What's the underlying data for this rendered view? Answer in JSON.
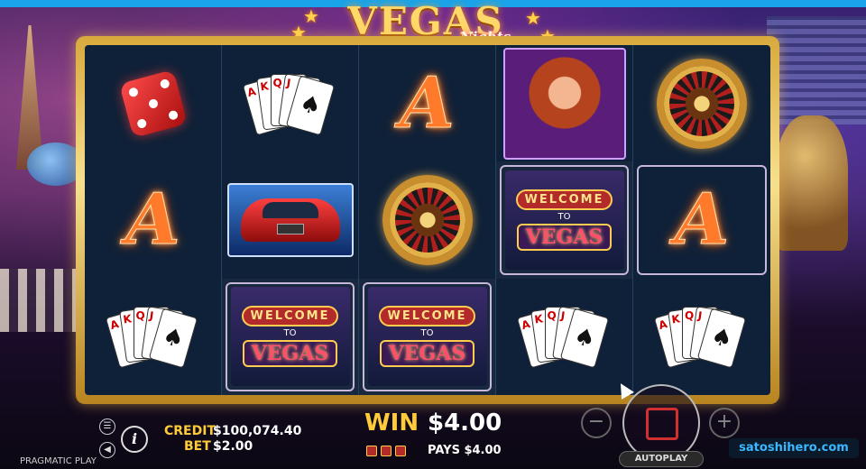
{
  "game": {
    "logo_main": "VEGAS",
    "logo_sub": "Nights",
    "provider": "PRAGMATIC PLAY",
    "watermark_site": "satoshihero.com"
  },
  "reels": [
    [
      "red-dice",
      "playing-cards",
      "letter-a"
    ],
    [
      "playing-cards",
      "red-car",
      "welcome-to-vegas-sign"
    ],
    [
      "letter-a",
      "roulette-wheel",
      "welcome-to-vegas-sign"
    ],
    [
      "lady-portrait",
      "welcome-to-vegas-sign",
      "playing-cards"
    ],
    [
      "roulette-wheel",
      "letter-a",
      "playing-cards"
    ]
  ],
  "symbols_text": {
    "letter_a": "A",
    "welcome": "WELCOME",
    "to": "TO",
    "vegas": "VEGAS",
    "card_corners": [
      "A",
      "K",
      "Q",
      "J",
      "♠"
    ]
  },
  "hud": {
    "credit_label": "CREDIT",
    "credit_value": "$100,074.40",
    "bet_label": "BET",
    "bet_value": "$2.00",
    "win_label": "WIN",
    "win_value": "$4.00",
    "pays_text": "PAYS $4.00",
    "minus": "−",
    "plus": "+",
    "autoplay": "AUTOPLAY",
    "info": "i",
    "menu_glyph": "☰",
    "sound_glyph": "◀"
  },
  "colors": {
    "accent_gold": "#ffcb3a",
    "frame_gold": "#d8a93d",
    "reel_bg": "#0f2138",
    "spin_red": "#d03030",
    "site_blue": "#39b7ff"
  }
}
